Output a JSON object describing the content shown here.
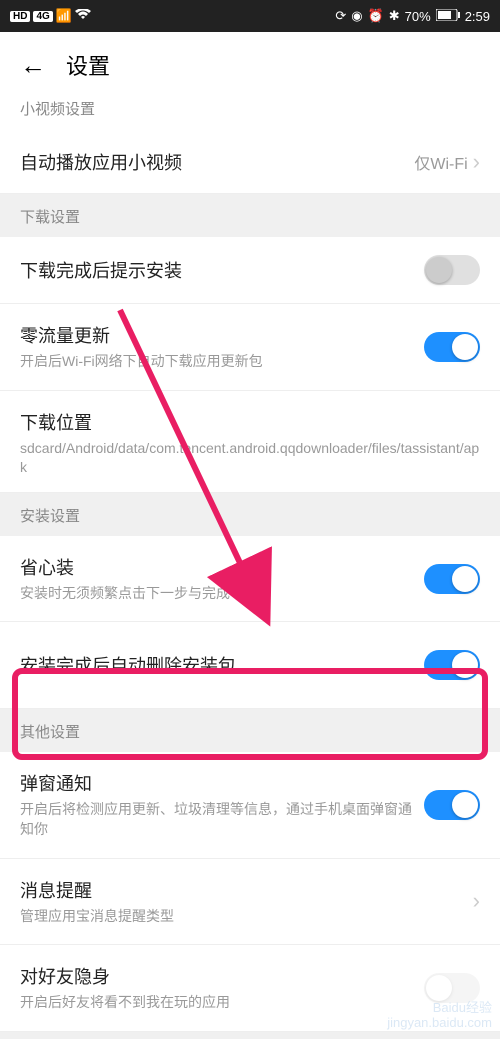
{
  "status": {
    "hd": "HD",
    "network_badge": "4G",
    "battery_pct": "70%",
    "time": "2:59"
  },
  "header": {
    "title": "设置"
  },
  "partial_top": "小视频设置",
  "item_autoplay": {
    "title": "自动播放应用小视频",
    "value": "仅Wi-Fi"
  },
  "section_download": "下载设置",
  "item_prompt": {
    "title": "下载完成后提示安装"
  },
  "item_zero": {
    "title": "零流量更新",
    "sub": "开启后Wi-Fi网络下自动下载应用更新包"
  },
  "item_location": {
    "title": "下载位置",
    "sub": "sdcard/Android/data/com.tencent.android.qqdownloader/files/tassistant/apk"
  },
  "section_install": "安装设置",
  "item_easy": {
    "title": "省心装",
    "sub": "安装时无须频繁点击下一步与完成"
  },
  "item_autodel": {
    "title": "安装完成后自动删除安装包"
  },
  "section_other": "其他设置",
  "item_popup": {
    "title": "弹窗通知",
    "sub": "开启后将检测应用更新、垃圾清理等信息，通过手机桌面弹窗通知你"
  },
  "item_msg": {
    "title": "消息提醒",
    "sub": "管理应用宝消息提醒类型"
  },
  "item_hide": {
    "title": "对好友隐身",
    "sub": "开启后好友将看不到我在玩的应用"
  },
  "watermark": {
    "line1": "Baidu经验",
    "line2": "jingyan.baidu.com"
  }
}
